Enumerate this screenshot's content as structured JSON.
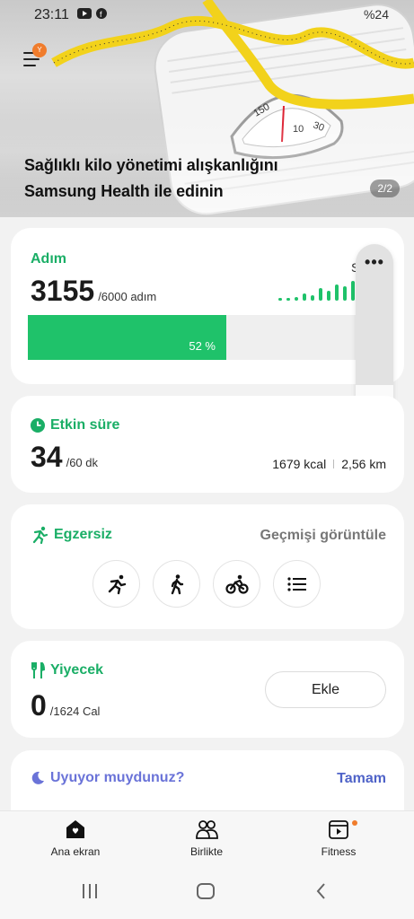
{
  "status_bar": {
    "time": "23:11",
    "right": "%24"
  },
  "hero": {
    "menu_badge": "Y",
    "title_line1": "Sağlıklı kilo yönetimi alışkanlığını",
    "title_line2": "Samsung Health ile edinin",
    "page_indicator": "2/2"
  },
  "steps": {
    "title": "Adım",
    "value": "3155",
    "goal": "/6000 adım",
    "progress_percent": 52,
    "progress_label": "52 %",
    "peek_letter": "S"
  },
  "volume_panel": {
    "more": "•••",
    "level_fraction": 0.33
  },
  "active_time": {
    "title": "Etkin süre",
    "value": "34",
    "goal": "/60 dk",
    "kcal": "1679 kcal",
    "distance": "2,56 km"
  },
  "exercise": {
    "title": "Egzersiz",
    "history_link": "Geçmişi görüntüle",
    "buttons": [
      "running-icon",
      "walking-icon",
      "cycling-icon",
      "list-icon"
    ]
  },
  "food": {
    "title": "Yiyecek",
    "value": "0",
    "goal": "/1624 Cal",
    "add_label": "Ekle"
  },
  "sleep": {
    "title": "Uyuyor muydunuz?",
    "action": "Tamam"
  },
  "bottom_nav": {
    "items": [
      {
        "label": "Ana ekran",
        "icon": "home-icon"
      },
      {
        "label": "Birlikte",
        "icon": "together-icon"
      },
      {
        "label": "Fitness",
        "icon": "fitness-icon"
      }
    ]
  },
  "colors": {
    "accent_green": "#1fc26a",
    "title_green": "#1aae66",
    "sleep_purple": "#6a73d8",
    "badge_orange": "#f07c2c"
  }
}
